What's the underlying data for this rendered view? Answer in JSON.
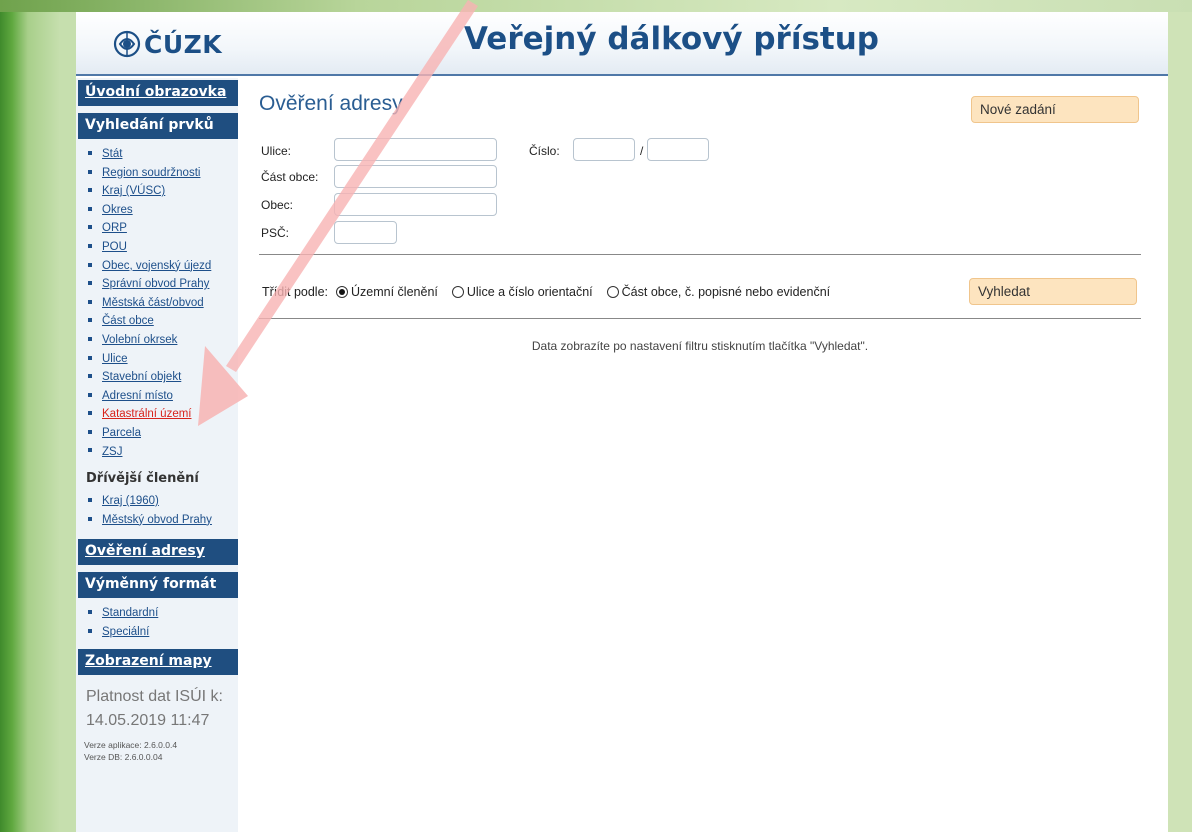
{
  "header": {
    "logo_text": "ČÚZK",
    "site_title": "Veřejný dálkový přístup"
  },
  "sidebar": {
    "home": "Úvodní obrazovka",
    "search_head": "Vyhledání prvků",
    "items": [
      {
        "label": "Stát"
      },
      {
        "label": "Region soudržnosti"
      },
      {
        "label": "Kraj (VÚSC)"
      },
      {
        "label": "Okres"
      },
      {
        "label": "ORP"
      },
      {
        "label": "POU"
      },
      {
        "label": "Obec, vojenský újezd"
      },
      {
        "label": "Správní obvod Prahy"
      },
      {
        "label": "Městská část/obvod"
      },
      {
        "label": "Část obce"
      },
      {
        "label": "Volební okrsek"
      },
      {
        "label": "Ulice"
      },
      {
        "label": "Stavební objekt"
      },
      {
        "label": "Adresní místo"
      },
      {
        "label": "Katastrální území",
        "active": true
      },
      {
        "label": "Parcela"
      },
      {
        "label": "ZSJ"
      }
    ],
    "former_head": "Dřívější členění",
    "former_items": [
      {
        "label": "Kraj (1960)"
      },
      {
        "label": "Městský obvod Prahy"
      }
    ],
    "address_check": "Ověření adresy",
    "exchange_head": "Výměnný formát",
    "exchange_items": [
      {
        "label": "Standardní"
      },
      {
        "label": "Speciální"
      }
    ],
    "map_head": "Zobrazení mapy",
    "validity_label": "Platnost dat ISÚI k:",
    "validity_date": "14.05.2019 11:47",
    "app_version": "Verze aplikace: 2.6.0.0.4",
    "db_version": "Verze DB: 2.6.0.0.04"
  },
  "main": {
    "title": "Ověření adresy",
    "new_entry": "Nové zadání",
    "fields": {
      "street": "Ulice:",
      "number": "Číslo:",
      "number_sep": "/",
      "part": "Část obce:",
      "municipality": "Obec:",
      "zip": "PSČ:"
    },
    "sort_label": "Třídit podle:",
    "sort_options": [
      {
        "label": "Územní členění",
        "selected": true
      },
      {
        "label": "Ulice a číslo orientační",
        "selected": false
      },
      {
        "label": "Část obce, č. popisné nebo evidenční",
        "selected": false
      }
    ],
    "search_button": "Vyhledat",
    "hint": "Data zobrazíte po nastavení filtru stisknutím tlačítka \"Vyhledat\"."
  },
  "colors": {
    "nav_bg": "#1f4e80",
    "link": "#1d4f8a",
    "active_link": "#d8241c",
    "button_bg": "#fde4bf",
    "annotation_arrow": "#f7b3b3"
  }
}
